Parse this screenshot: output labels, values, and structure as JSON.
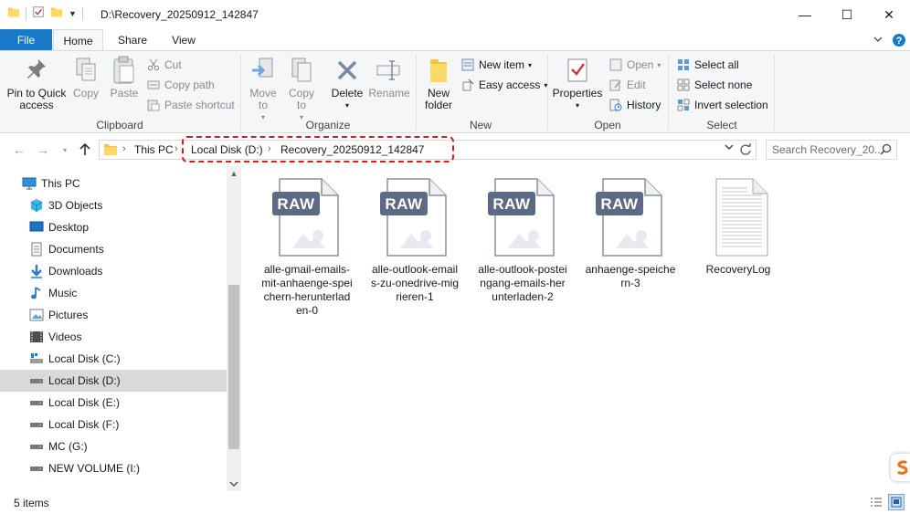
{
  "window": {
    "title": "D:\\Recovery_20250912_142847",
    "minimize": "—",
    "maximize": "☐",
    "close": "✕"
  },
  "tabs": {
    "file": "File",
    "home": "Home",
    "share": "Share",
    "view": "View"
  },
  "ribbon": {
    "clipboard": {
      "label": "Clipboard",
      "pin_line1": "Pin to Quick",
      "pin_line2": "access",
      "copy": "Copy",
      "paste": "Paste",
      "cut": "Cut",
      "copy_path": "Copy path",
      "paste_shortcut": "Paste shortcut"
    },
    "organize": {
      "label": "Organize",
      "move_line1": "Move",
      "move_line2": "to",
      "copy_line1": "Copy",
      "copy_line2": "to",
      "delete": "Delete",
      "rename": "Rename"
    },
    "new": {
      "label": "New",
      "new_folder_line1": "New",
      "new_folder_line2": "folder",
      "new_item": "New item",
      "easy_access": "Easy access"
    },
    "open": {
      "label": "Open",
      "properties": "Properties",
      "open": "Open",
      "edit": "Edit",
      "history": "History"
    },
    "select": {
      "label": "Select",
      "select_all": "Select all",
      "select_none": "Select none",
      "invert_selection": "Invert selection"
    }
  },
  "address": {
    "this_pc": "This PC",
    "drive": "Local Disk (D:)",
    "folder": "Recovery_20250912_142847",
    "search_placeholder": "Search Recovery_20..."
  },
  "nav": {
    "items": [
      {
        "label": "This PC"
      },
      {
        "label": "3D Objects"
      },
      {
        "label": "Desktop"
      },
      {
        "label": "Documents"
      },
      {
        "label": "Downloads"
      },
      {
        "label": "Music"
      },
      {
        "label": "Pictures"
      },
      {
        "label": "Videos"
      },
      {
        "label": "Local Disk (C:)"
      },
      {
        "label": "Local Disk (D:)"
      },
      {
        "label": "Local Disk (E:)"
      },
      {
        "label": "Local Disk (F:)"
      },
      {
        "label": "MC (G:)"
      },
      {
        "label": "NEW VOLUME (I:)"
      }
    ]
  },
  "files": [
    {
      "name": "alle-gmail-emails-mit-anhaenge-speichern-herunterladen-0",
      "badge": "RAW"
    },
    {
      "name": "alle-outlook-emails-zu-onedrive-migrieren-1",
      "badge": "RAW"
    },
    {
      "name": "alle-outlook-posteingang-emails-herunterladen-2",
      "badge": "RAW"
    },
    {
      "name": "anhaenge-speichern-3",
      "badge": "RAW"
    },
    {
      "name": "RecoveryLog",
      "badge": ""
    }
  ],
  "status": {
    "count": "5 items"
  },
  "colors": {
    "accent": "#1979ca",
    "highlight": "#d81e1e",
    "raw_badge": "#5b6b86"
  }
}
